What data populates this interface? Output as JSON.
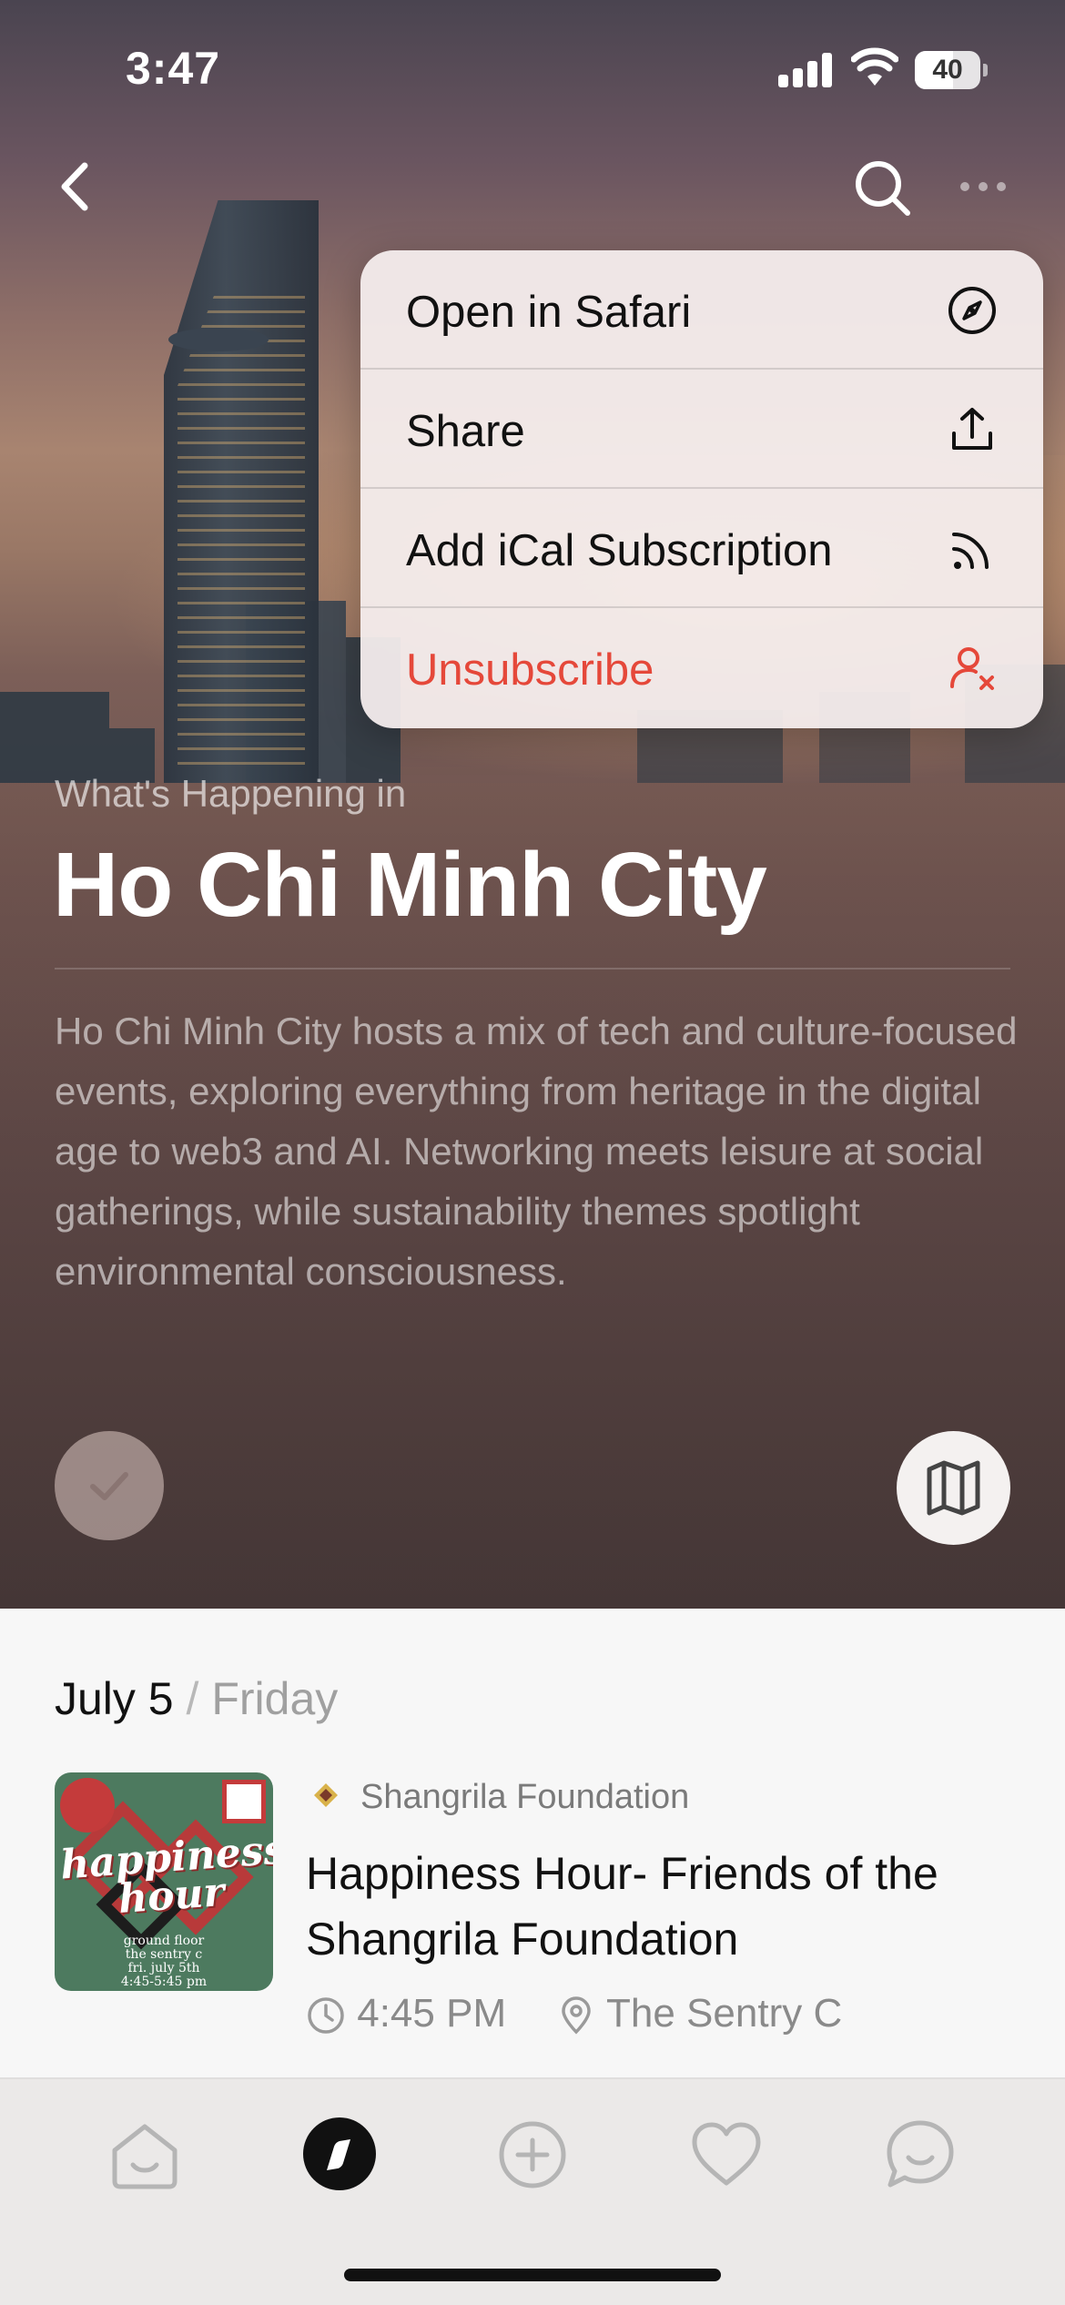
{
  "status_bar": {
    "time": "3:47",
    "battery": "40"
  },
  "menu": {
    "items": [
      {
        "label": "Open in Safari",
        "icon": "compass-icon"
      },
      {
        "label": "Share",
        "icon": "share-icon"
      },
      {
        "label": "Add iCal Subscription",
        "icon": "rss-icon"
      },
      {
        "label": "Unsubscribe",
        "icon": "user-remove-icon"
      }
    ]
  },
  "hero": {
    "eyebrow": "What's Happening in",
    "title": "Ho Chi Minh City",
    "description": "Ho Chi Minh City hosts a mix of tech and culture-focused events, exploring everything from heritage in the digital age to web3 and AI. Networking meets leisure at social gatherings, while sustainability themes spotlight environmental consciousness."
  },
  "events": {
    "date": "July 5",
    "separator": "/",
    "weekday": "Friday",
    "items": [
      {
        "organizer": "Shangrila Foundation",
        "title": "Happiness Hour- Friends of the Shangrila Foundation",
        "time": "4:45 PM",
        "location": "The Sentry C",
        "thumb_words": [
          "happiness",
          "hour"
        ],
        "thumb_lines": [
          "ground floor",
          "the sentry c",
          "fri. july 5th",
          "4:45-5:45 pm"
        ]
      }
    ]
  },
  "tabs": [
    "home-tab",
    "explore-tab",
    "create-tab",
    "favorites-tab",
    "chat-tab"
  ],
  "colors": {
    "danger": "#e5483a",
    "accent": "#111111"
  }
}
